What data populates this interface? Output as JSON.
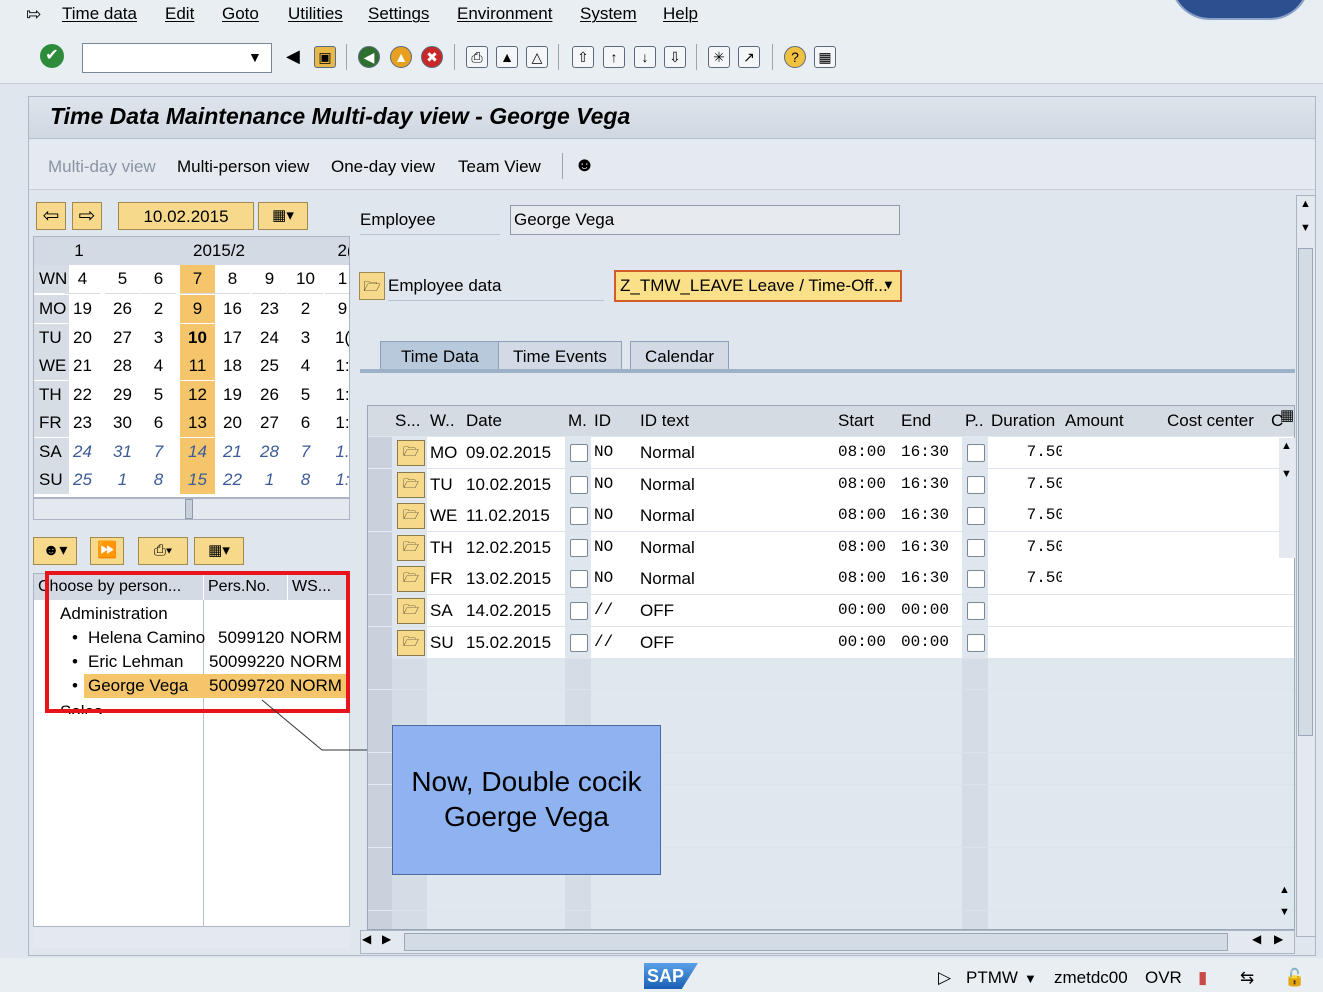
{
  "menu": [
    "Time data",
    "Edit",
    "Goto",
    "Utilities",
    "Settings",
    "Environment",
    "System",
    "Help"
  ],
  "title": "Time Data Maintenance Multi-day view - George Vega",
  "app_toolbar": [
    "Multi-day view",
    "Multi-person view",
    "One-day view",
    "Team View"
  ],
  "calendar": {
    "date": "10.02.2015",
    "months_row": [
      "1",
      "2015/2",
      "2("
    ],
    "weeks": [
      "4",
      "5",
      "6",
      "7",
      "8",
      "9",
      "10",
      "1"
    ],
    "wn_label": "WN",
    "rows": [
      {
        "day": "MO",
        "dates": [
          "19",
          "26",
          "2",
          "9",
          "16",
          "23",
          "2",
          "9"
        ]
      },
      {
        "day": "TU",
        "dates": [
          "20",
          "27",
          "3",
          "10",
          "17",
          "24",
          "3",
          "1("
        ]
      },
      {
        "day": "WE",
        "dates": [
          "21",
          "28",
          "4",
          "11",
          "18",
          "25",
          "4",
          "1:"
        ]
      },
      {
        "day": "TH",
        "dates": [
          "22",
          "29",
          "5",
          "12",
          "19",
          "26",
          "5",
          "1:"
        ]
      },
      {
        "day": "FR",
        "dates": [
          "23",
          "30",
          "6",
          "13",
          "20",
          "27",
          "6",
          "1:"
        ]
      },
      {
        "day": "SA",
        "dates": [
          "24",
          "31",
          "7",
          "14",
          "21",
          "28",
          "7",
          "1."
        ]
      },
      {
        "day": "SU",
        "dates": [
          "25",
          "1",
          "8",
          "15",
          "22",
          "1",
          "8",
          "1:"
        ]
      }
    ]
  },
  "tree": {
    "headers": [
      "Choose by person...",
      "Pers.No.",
      "WS..."
    ],
    "group": "Administration",
    "people": [
      {
        "name": "Helena Camino",
        "pers": "5099120",
        "ws": "NORM"
      },
      {
        "name": "Eric Lehman",
        "pers": "50099220",
        "ws": "NORM"
      },
      {
        "name": "George Vega",
        "pers": "50099720",
        "ws": "NORM"
      }
    ],
    "next_group": "Sales"
  },
  "employee_label": "Employee",
  "employee_value": "George Vega",
  "employee_data_label": "Employee data",
  "layout_variant": "Z_TMW_LEAVE Leave / Time-Off...",
  "tabs": [
    "Time Data",
    "Time Events",
    "Calendar"
  ],
  "grid": {
    "headers": [
      "S...",
      "W..",
      "Date",
      "M.",
      "ID",
      "ID text",
      "Start",
      "End",
      "P..",
      "Duration",
      "Amount",
      "Cost center",
      "C"
    ],
    "rows": [
      {
        "wd": "MO",
        "date": "09.02.2015",
        "id": "NO",
        "text": "Normal",
        "start": "08:00",
        "end": "16:30",
        "dur": "7.50"
      },
      {
        "wd": "TU",
        "date": "10.02.2015",
        "id": "NO",
        "text": "Normal",
        "start": "08:00",
        "end": "16:30",
        "dur": "7.50"
      },
      {
        "wd": "WE",
        "date": "11.02.2015",
        "id": "NO",
        "text": "Normal",
        "start": "08:00",
        "end": "16:30",
        "dur": "7.50"
      },
      {
        "wd": "TH",
        "date": "12.02.2015",
        "id": "NO",
        "text": "Normal",
        "start": "08:00",
        "end": "16:30",
        "dur": "7.50"
      },
      {
        "wd": "FR",
        "date": "13.02.2015",
        "id": "NO",
        "text": "Normal",
        "start": "08:00",
        "end": "16:30",
        "dur": "7.50"
      },
      {
        "wd": "SA",
        "date": "14.02.2015",
        "id": "//",
        "text": "OFF",
        "start": "00:00",
        "end": "00:00",
        "dur": ""
      },
      {
        "wd": "SU",
        "date": "15.02.2015",
        "id": "//",
        "text": "OFF",
        "start": "00:00",
        "end": "00:00",
        "dur": ""
      }
    ]
  },
  "callout": "Now, Double cocik Goerge Vega",
  "status": {
    "logo": "SAP",
    "tcode": "PTMW",
    "server": "zmetdc00",
    "mode": "OVR"
  },
  "colors": {
    "highlight": "#f4c56a",
    "callout": "#8fb3f0",
    "redbox": "#e8141c"
  }
}
